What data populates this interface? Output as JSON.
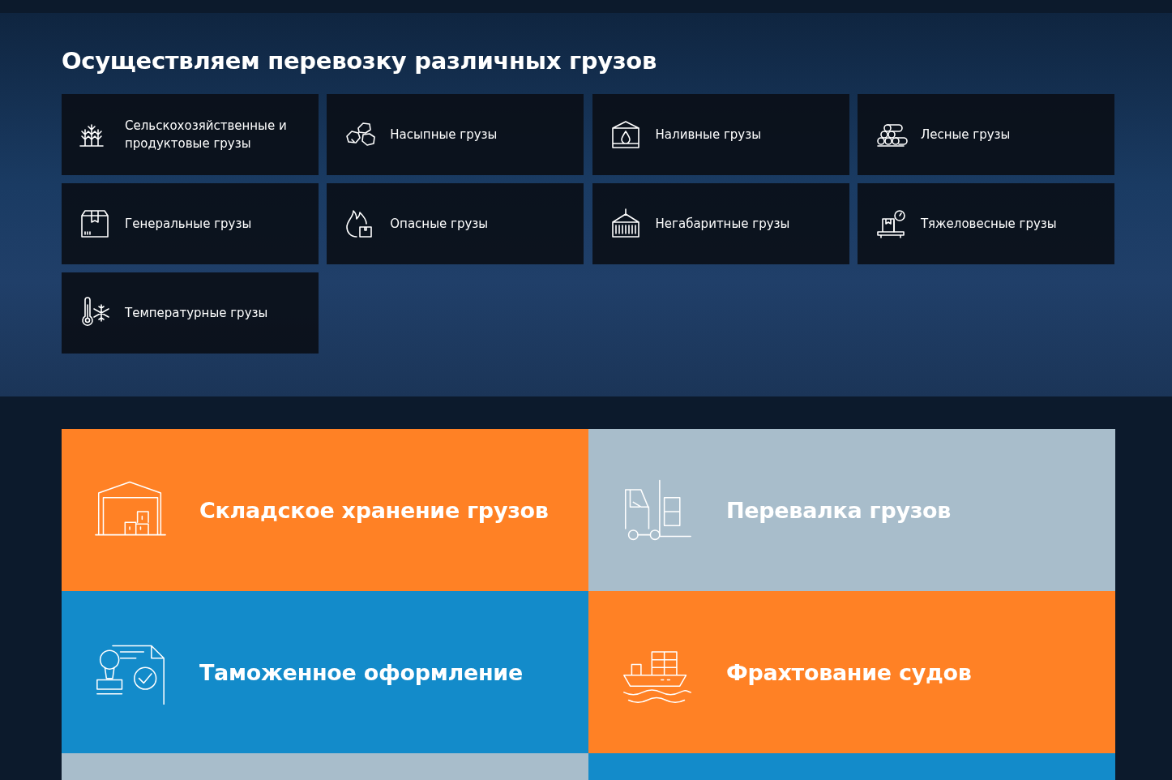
{
  "cargo_section": {
    "title": "Осуществляем перевозку различных грузов",
    "items": [
      {
        "label": "Сельскохозяйственные и продуктовые грузы"
      },
      {
        "label": "Насыпные грузы"
      },
      {
        "label": "Наливные грузы"
      },
      {
        "label": "Лесные грузы"
      },
      {
        "label": "Генеральные грузы"
      },
      {
        "label": "Опасные грузы"
      },
      {
        "label": "Негабаритные грузы"
      },
      {
        "label": "Тяжеловесные грузы"
      },
      {
        "label": "Температурные грузы"
      }
    ]
  },
  "services": [
    {
      "title": "Складское хранение грузов",
      "color": "#ff8125"
    },
    {
      "title": "Перевалка грузов",
      "color": "#a8bdcb"
    },
    {
      "title": "Таможенное оформление",
      "color": "#138bca"
    },
    {
      "title": "Фрахтование судов",
      "color": "#ff8125"
    },
    {
      "color": "#a8bdcb"
    },
    {
      "color": "#138bca"
    }
  ]
}
